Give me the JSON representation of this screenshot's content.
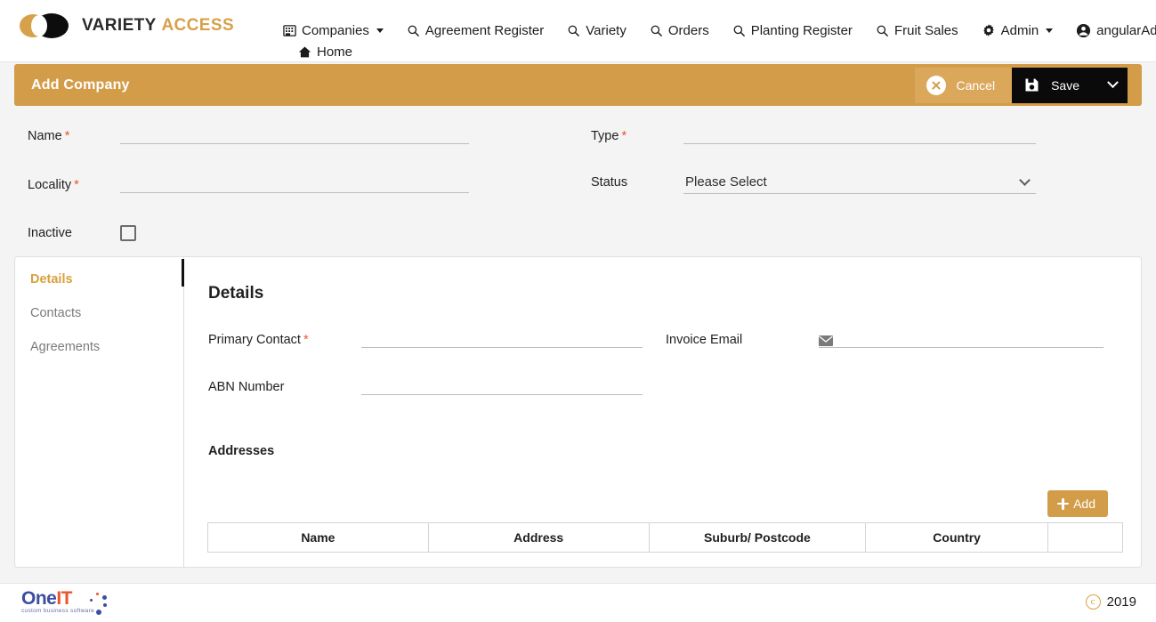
{
  "brand": {
    "part1": "VARIETY",
    "part2": "ACCESS"
  },
  "nav": {
    "primary": [
      {
        "label": "Companies",
        "icon": "building-icon",
        "caret": true
      },
      {
        "label": "Agreement Register",
        "icon": "search-icon",
        "caret": false
      },
      {
        "label": "Variety",
        "icon": "search-icon",
        "caret": false
      },
      {
        "label": "Orders",
        "icon": "search-icon",
        "caret": false
      },
      {
        "label": "Planting Register",
        "icon": "search-icon",
        "caret": false
      },
      {
        "label": "Fruit Sales",
        "icon": "search-icon",
        "caret": false
      },
      {
        "label": "Admin",
        "icon": "gear-icon",
        "caret": true
      }
    ],
    "user": {
      "label": "angularAdmin",
      "icon": "account-circle-icon",
      "caret": true
    },
    "home": {
      "label": "Home",
      "icon": "home-icon"
    }
  },
  "pagebar": {
    "title": "Add Company",
    "cancel_label": "Cancel",
    "save_label": "Save"
  },
  "form": {
    "name": {
      "label": "Name",
      "required": true,
      "value": ""
    },
    "type": {
      "label": "Type",
      "required": true,
      "value": ""
    },
    "locality": {
      "label": "Locality",
      "required": true,
      "value": ""
    },
    "status": {
      "label": "Status",
      "required": false,
      "value": "Please Select"
    },
    "inactive": {
      "label": "Inactive",
      "checked": false
    }
  },
  "tabs": [
    {
      "label": "Details",
      "active": true
    },
    {
      "label": "Contacts",
      "active": false
    },
    {
      "label": "Agreements",
      "active": false
    }
  ],
  "details": {
    "heading": "Details",
    "primary_contact": {
      "label": "Primary Contact",
      "required": true,
      "value": ""
    },
    "invoice_email": {
      "label": "Invoice Email",
      "required": false,
      "value": "",
      "icon": "envelope-icon"
    },
    "abn_number": {
      "label": "ABN Number",
      "required": false,
      "value": ""
    }
  },
  "addresses": {
    "heading": "Addresses",
    "add_label": "Add",
    "columns": [
      "Name",
      "Address",
      "Suburb/ Postcode",
      "Country"
    ],
    "rows": []
  },
  "footer": {
    "logo_one": "One",
    "logo_it": "IT",
    "logo_tagline": "custom business software",
    "copyright_year": "2019"
  },
  "colors": {
    "accent": "#d39c49",
    "accent_text": "#d9a13e",
    "required": "#e8562b",
    "save_bg": "#0a0a0a",
    "page_bg": "#f4f4f4"
  }
}
